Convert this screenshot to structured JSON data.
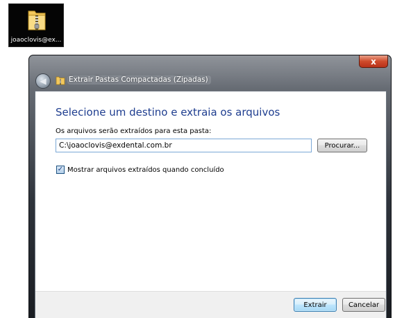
{
  "desktop": {
    "icon_name": "zip-folder-icon",
    "label": "joaoclovis@ex..."
  },
  "window": {
    "title": "Extrair Pastas Compactadas (Zipadas)",
    "close_label": "x",
    "back_icon": "back-arrow-icon",
    "heading": "Selecione um destino e extraia os arquivos",
    "path_label": "Os arquivos serão extraídos para esta pasta:",
    "path_value": "C:\\joaoclovis@exdental.com.br",
    "browse_label": "Procurar...",
    "checkbox": {
      "checked": true,
      "mark": "✓",
      "label": "Mostrar arquivos extraídos quando concluído"
    },
    "footer": {
      "extract_label": "Extrair",
      "cancel_label": "Cancelar"
    }
  },
  "colors": {
    "heading": "#1e3d8f",
    "close_button": "#cf4b2b",
    "default_button_border": "#3c7fb1",
    "input_border": "#7aa7d6"
  }
}
